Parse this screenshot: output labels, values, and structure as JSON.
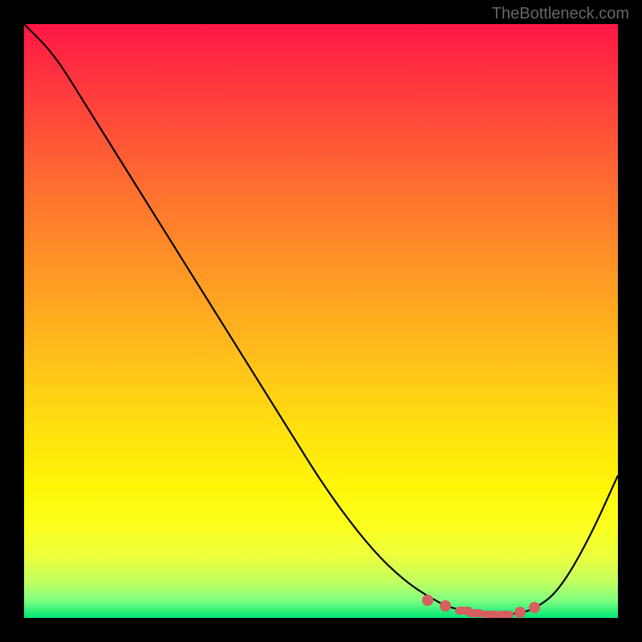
{
  "watermark": "TheBottleneck.com",
  "chart_data": {
    "type": "line",
    "title": "",
    "xlabel": "",
    "ylabel": "",
    "x": [
      0,
      0.05,
      0.1,
      0.15,
      0.2,
      0.25,
      0.3,
      0.35,
      0.4,
      0.45,
      0.5,
      0.55,
      0.6,
      0.65,
      0.7,
      0.72,
      0.75,
      0.78,
      0.8,
      0.83,
      0.86,
      0.9,
      0.95,
      1.0
    ],
    "values": [
      1.0,
      0.95,
      0.87,
      0.79,
      0.71,
      0.63,
      0.55,
      0.47,
      0.39,
      0.31,
      0.23,
      0.16,
      0.1,
      0.055,
      0.025,
      0.017,
      0.01,
      0.006,
      0.005,
      0.007,
      0.015,
      0.045,
      0.13,
      0.24
    ],
    "xlim": [
      0,
      1
    ],
    "ylim": [
      0,
      1
    ],
    "markers_x": [
      0.68,
      0.71,
      0.74,
      0.76,
      0.785,
      0.81,
      0.835,
      0.86
    ],
    "markers_y": [
      0.03,
      0.02,
      0.012,
      0.008,
      0.005,
      0.006,
      0.01,
      0.018
    ],
    "background": "heatmap-gradient-red-to-green"
  }
}
